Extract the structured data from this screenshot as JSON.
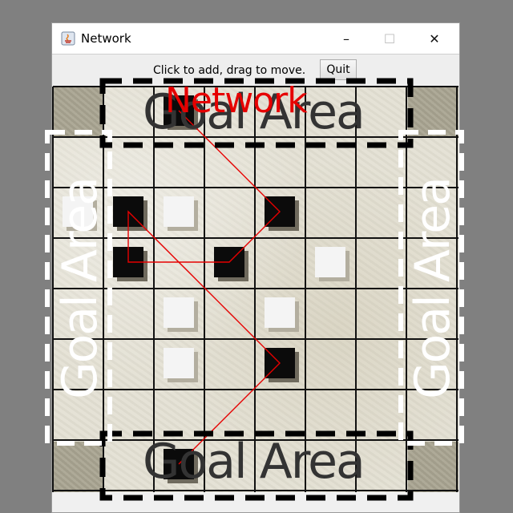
{
  "window": {
    "title": "Network",
    "minimize_glyph": "–",
    "maximize_glyph": "☐",
    "close_glyph": "✕"
  },
  "toolbar": {
    "instructions": "Click to add, drag to move.",
    "quit_label": "Quit"
  },
  "board": {
    "size": 8,
    "goal_labels": {
      "top": "Goal Area",
      "bottom": "Goal Area",
      "left": "Goal Area",
      "right": "Goal Area"
    },
    "network_label": "Network",
    "pieces": [
      {
        "color": "black",
        "col": 2,
        "row": 0
      },
      {
        "color": "black",
        "col": 1,
        "row": 2
      },
      {
        "color": "white",
        "col": 0,
        "row": 2
      },
      {
        "color": "white",
        "col": 2,
        "row": 2
      },
      {
        "color": "black",
        "col": 4,
        "row": 2
      },
      {
        "color": "black",
        "col": 1,
        "row": 3
      },
      {
        "color": "black",
        "col": 3,
        "row": 3
      },
      {
        "color": "white",
        "col": 5,
        "row": 3
      },
      {
        "color": "white",
        "col": 2,
        "row": 4
      },
      {
        "color": "white",
        "col": 4,
        "row": 4
      },
      {
        "color": "white",
        "col": 2,
        "row": 5
      },
      {
        "color": "black",
        "col": 4,
        "row": 5
      },
      {
        "color": "black",
        "col": 2,
        "row": 7
      }
    ],
    "network_path": [
      [
        2,
        0
      ],
      [
        4,
        2
      ],
      [
        3,
        3
      ],
      [
        1,
        3
      ],
      [
        1,
        2
      ],
      [
        4,
        5
      ],
      [
        2,
        7
      ]
    ],
    "colors": {
      "network_line": "#e60000",
      "goal_box_dark": "#000000",
      "goal_box_light": "#ffffff"
    }
  }
}
